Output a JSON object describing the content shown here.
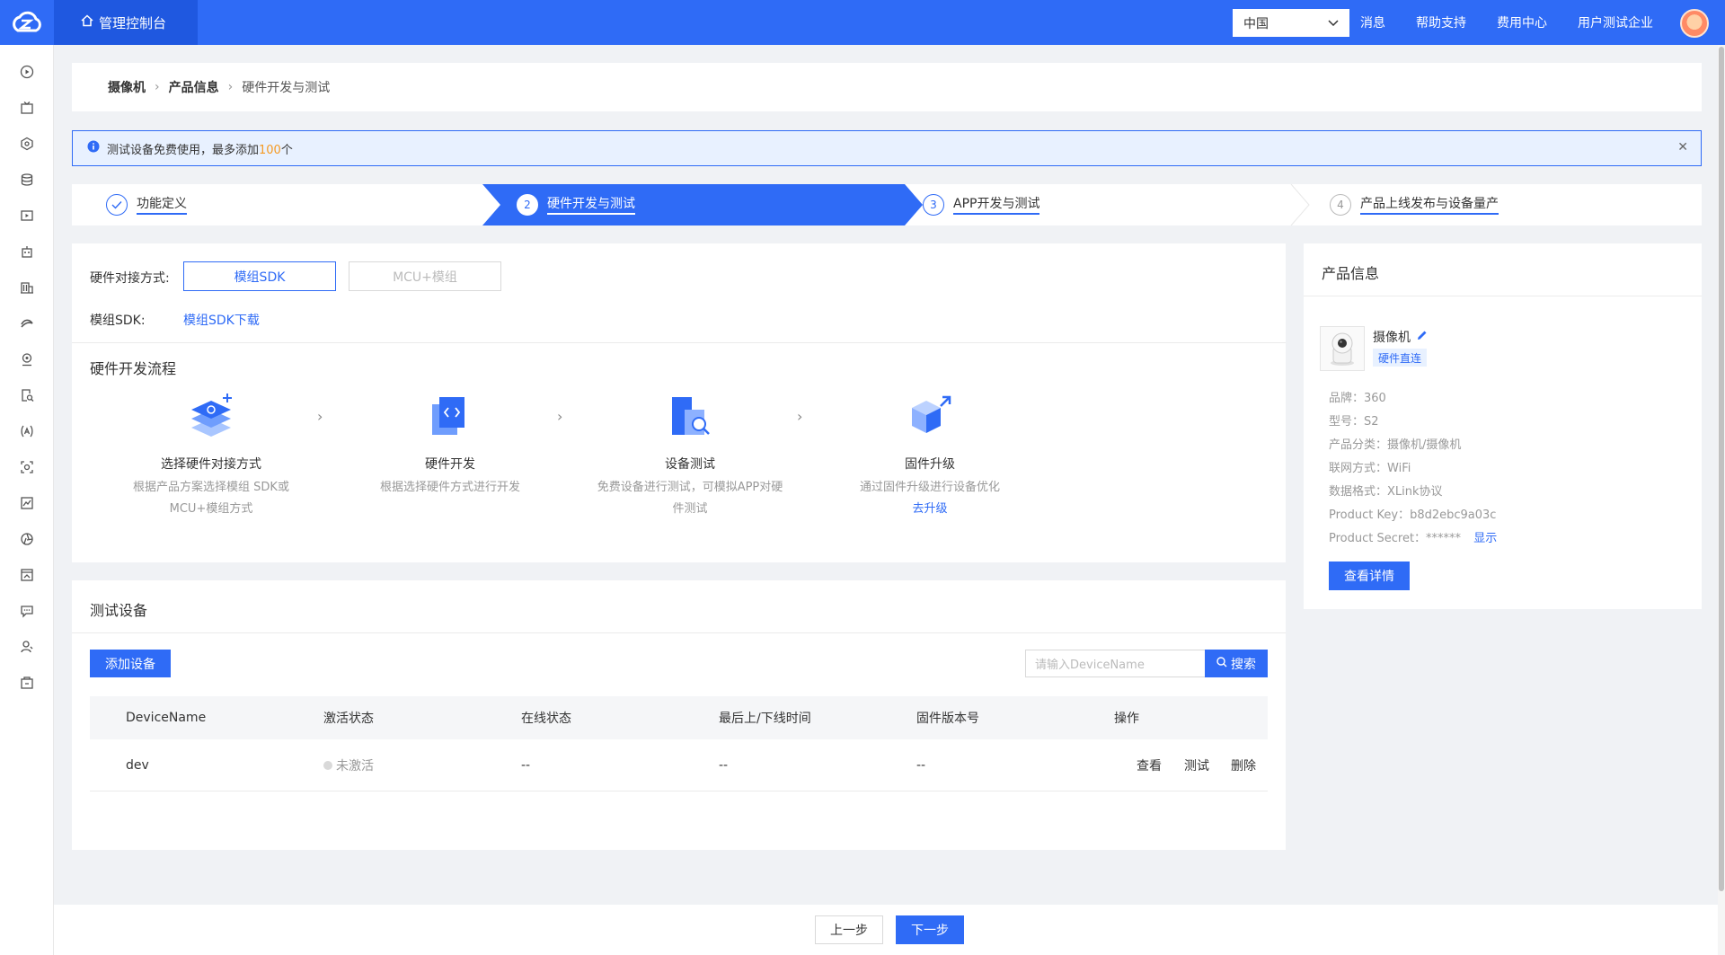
{
  "header": {
    "console_label": "管理控制台",
    "region": "中国",
    "links": [
      "消息",
      "帮助支持",
      "费用中心",
      "用户测试企业"
    ]
  },
  "breadcrumb": {
    "items": [
      "摄像机",
      "产品信息"
    ],
    "current": "硬件开发与测试"
  },
  "notice": {
    "text_before": "测试设备免费使用，最多添加",
    "highlight": "100",
    "text_after": "个"
  },
  "steps": [
    {
      "num": "",
      "label": "功能定义"
    },
    {
      "num": "2",
      "label": "硬件开发与测试"
    },
    {
      "num": "3",
      "label": "APP开发与测试"
    },
    {
      "num": "4",
      "label": "产品上线发布与设备量产"
    }
  ],
  "hardware": {
    "mode_label": "硬件对接方式:",
    "mode_options": [
      "模组SDK",
      "MCU+模组"
    ],
    "sdk_label": "模组SDK:",
    "sdk_link": "模组SDK下载",
    "flow_title": "硬件开发流程",
    "flow": [
      {
        "title": "选择硬件对接方式",
        "desc1": "根据产品方案选择模组 SDK或",
        "desc2": "MCU+模组方式",
        "link": ""
      },
      {
        "title": "硬件开发",
        "desc1": "根据选择硬件方式进行开发",
        "desc2": "",
        "link": ""
      },
      {
        "title": "设备测试",
        "desc1": "免费设备进行测试，可模拟APP对硬",
        "desc2": "件测试",
        "link": ""
      },
      {
        "title": "固件升级",
        "desc1": "通过固件升级进行设备优化",
        "desc2": "",
        "link": "去升级"
      }
    ]
  },
  "devices": {
    "title": "测试设备",
    "add_button": "添加设备",
    "search_placeholder": "请输入DeviceName",
    "search_button": "搜索",
    "columns": [
      "DeviceName",
      "激活状态",
      "在线状态",
      "最后上/下线时间",
      "固件版本号",
      "操作"
    ],
    "rows": [
      {
        "name": "dev",
        "activation": "未激活",
        "online": "--",
        "last_time": "--",
        "firmware": "--",
        "actions": [
          "查看",
          "测试",
          "删除"
        ]
      }
    ]
  },
  "product_info": {
    "title": "产品信息",
    "name": "摄像机",
    "tag": "硬件直连",
    "fields": [
      {
        "label": "品牌：",
        "value": "360"
      },
      {
        "label": "型号：",
        "value": "S2"
      },
      {
        "label": "产品分类：",
        "value": "摄像机/摄像机"
      },
      {
        "label": "联网方式：",
        "value": "WiFi"
      },
      {
        "label": "数据格式：",
        "value": "XLink协议"
      },
      {
        "label": "Product Key：",
        "value": "b8d2ebc9a03c"
      }
    ],
    "secret_label": "Product Secret：",
    "secret_value": "******",
    "secret_show": "显示",
    "detail_button": "查看详情"
  },
  "footer": {
    "prev": "上一步",
    "next": "下一步"
  },
  "colors": {
    "primary": "#2f6bf6",
    "notice_highlight": "#f59a23"
  }
}
